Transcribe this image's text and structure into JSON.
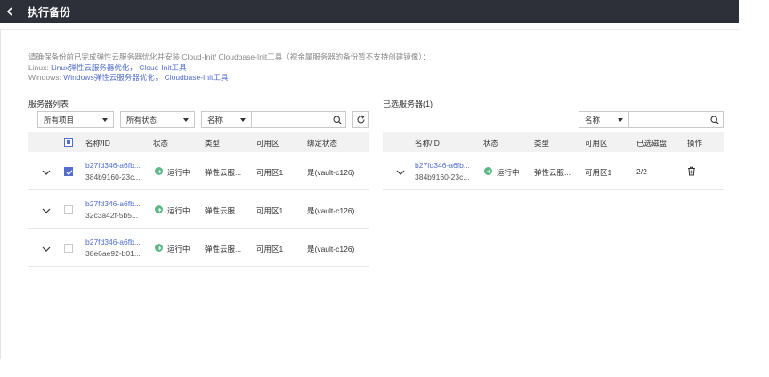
{
  "header": {
    "title": "执行备份"
  },
  "notice": {
    "line1": "请确保备份前已完成弹性云服务器优化并安装 Cloud-Init/ Cloudbase-Init工具（裸金属服务器的备份暂不支持创建镜像）：",
    "linux_prefix": "Linux:",
    "linux_link1": "Linux弹性云服务器优化，",
    "linux_link2": "Cloud-Init工具",
    "windows_prefix": "Windows:",
    "windows_link1": "Windows弹性云服务器优化，",
    "windows_link2": "Cloudbase-Init工具"
  },
  "left": {
    "title": "服务器列表",
    "project_filter": "所有项目",
    "status_filter": "所有状态",
    "search_field": "名称",
    "columns": {
      "name": "名称/ID",
      "status": "状态",
      "type": "类型",
      "az": "可用区",
      "bound": "绑定状态"
    },
    "rows": [
      {
        "name": "b27fd346-a6fb...",
        "id": "384b9160-23c...",
        "status": "运行中",
        "type": "弹性云服...",
        "az": "可用区1",
        "bound": "是(vault-c126)",
        "checked": true
      },
      {
        "name": "b27fd346-a6fb...",
        "id": "32c3a42f-5b5...",
        "status": "运行中",
        "type": "弹性云服...",
        "az": "可用区1",
        "bound": "是(vault-c126)",
        "checked": false
      },
      {
        "name": "b27fd346-a6fb...",
        "id": "38e6ae92-b01...",
        "status": "运行中",
        "type": "弹性云服...",
        "az": "可用区1",
        "bound": "是(vault-c126)",
        "checked": false
      }
    ]
  },
  "right": {
    "title": "已选服务器(1)",
    "search_field": "名称",
    "columns": {
      "name": "名称/ID",
      "status": "状态",
      "type": "类型",
      "az": "可用区",
      "disks": "已选磁盘",
      "ops": "操作"
    },
    "rows": [
      {
        "name": "b27fd346-a6fb...",
        "id": "384b9160-23c...",
        "status": "运行中",
        "type": "弹性云服...",
        "az": "可用区1",
        "disks": "2/2"
      }
    ]
  },
  "colors": {
    "header_bg": "#2d3039",
    "link": "#526ecc",
    "status_green": "#5cb885"
  }
}
